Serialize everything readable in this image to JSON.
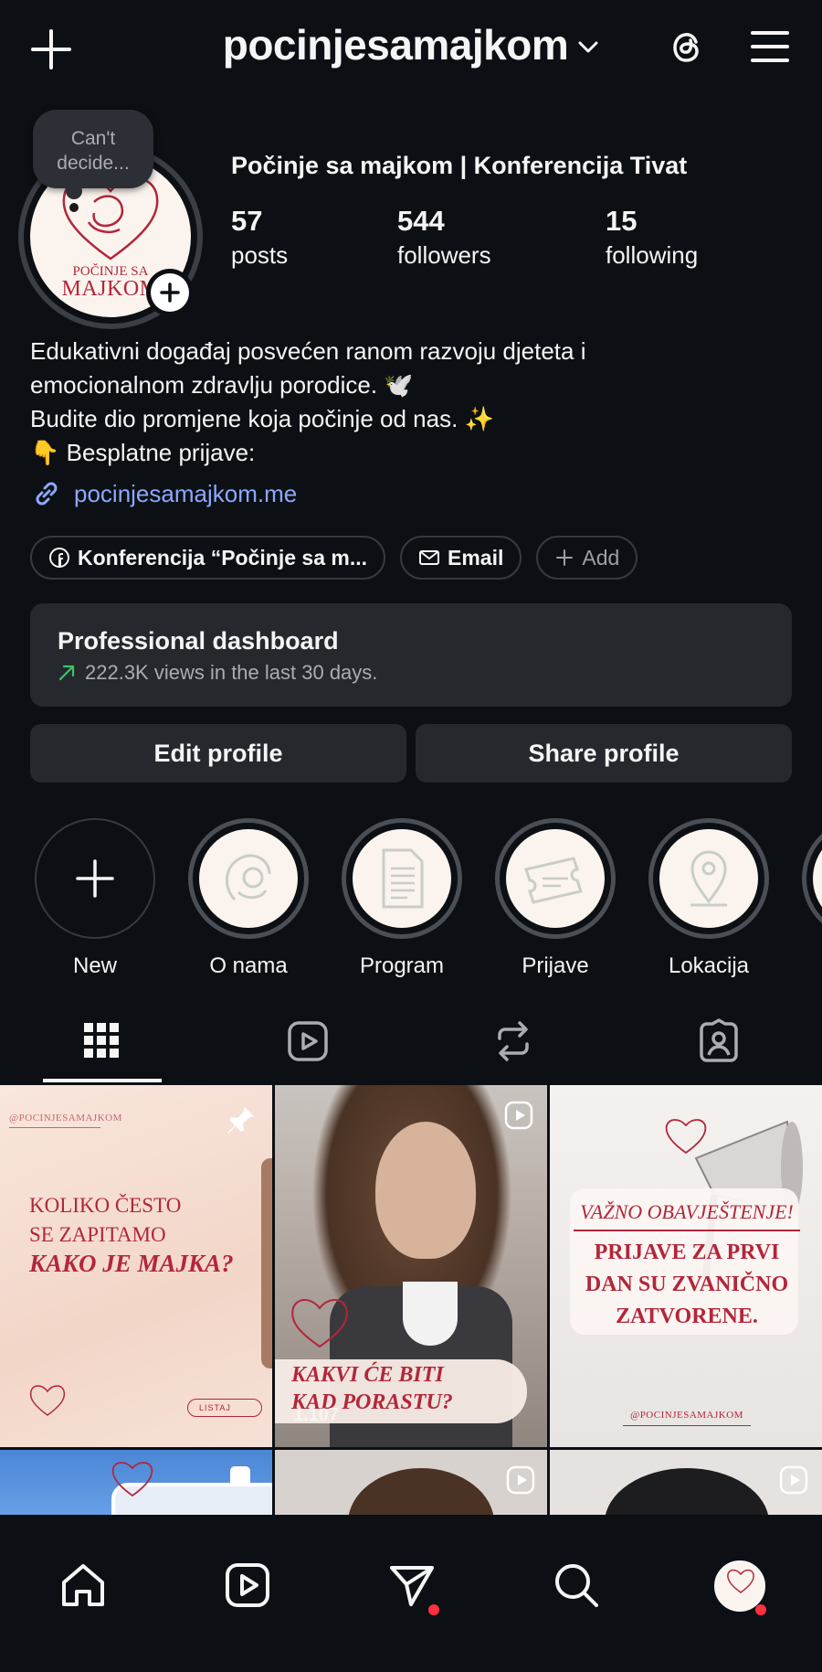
{
  "header": {
    "username": "pocinjesamajkom",
    "icons": [
      "plus-icon",
      "chevron-down-icon",
      "threads-icon",
      "menu-icon"
    ]
  },
  "note": {
    "text": "Can't decide..."
  },
  "profile": {
    "full_name": "Počinje sa majkom | Konferencija Tivat",
    "avatar_text_top": "POČINJE SA",
    "avatar_text_bottom": "MAJKOM",
    "stats": [
      {
        "value": "57",
        "label": "posts"
      },
      {
        "value": "544",
        "label": "followers"
      },
      {
        "value": "15",
        "label": "following"
      }
    ],
    "bio_lines": [
      "Edukativni događaj posvećen ranom razvoju djeteta i",
      "emocionalnom zdravlju porodice. 🕊️",
      "Budite dio promjene koja počinje od nas. ✨",
      "👇 Besplatne prijave:"
    ],
    "link": "pocinjesamajkom.me"
  },
  "pills": {
    "facebook": "Konferencija “Počinje sa m...",
    "email": "Email",
    "add": "Add"
  },
  "dashboard": {
    "title": "Professional dashboard",
    "subtitle": "222.3K views in the last 30 days.",
    "trend_color": "#3ec26b"
  },
  "buttons": {
    "edit": "Edit profile",
    "share": "Share profile"
  },
  "highlights": [
    {
      "label": "New",
      "icon": "plus-icon"
    },
    {
      "label": "O nama",
      "icon": "mother-child-icon"
    },
    {
      "label": "Program",
      "icon": "document-icon"
    },
    {
      "label": "Prijave",
      "icon": "ticket-icon"
    },
    {
      "label": "Lokacija",
      "icon": "location-pin-icon"
    }
  ],
  "tabs": [
    "grid-icon",
    "reels-icon",
    "reposts-icon",
    "tagged-icon"
  ],
  "posts": [
    {
      "handle": "@POCINJESAMAJKOM",
      "line1": "KOLIKO ČESTO",
      "line2": "SE ZAPITAMO",
      "line3": "KAKO JE MAJKA?",
      "button": "LISTAJ",
      "pinned": true
    },
    {
      "line1": "KAKVI ĆE BITI",
      "line2": "KAD PORASTU?",
      "views": "1.107",
      "type": "reel"
    },
    {
      "line1": "VAŽNO OBAVJEŠTENJE!",
      "line2": "PRIJAVE ZA PRVI",
      "line3": "DAN SU ZVANIČNO",
      "line4": "ZATVORENE.",
      "handle": "@POCINJESAMAJKOM"
    }
  ],
  "colors": {
    "background": "#0c1014",
    "surface": "#25292e",
    "link": "#8ca8ff",
    "brand_red": "#b3263a",
    "notification": "#ff3040"
  },
  "bottom_nav": [
    "home-icon",
    "reels-icon",
    "direct-messages-icon",
    "search-icon",
    "profile-avatar"
  ]
}
